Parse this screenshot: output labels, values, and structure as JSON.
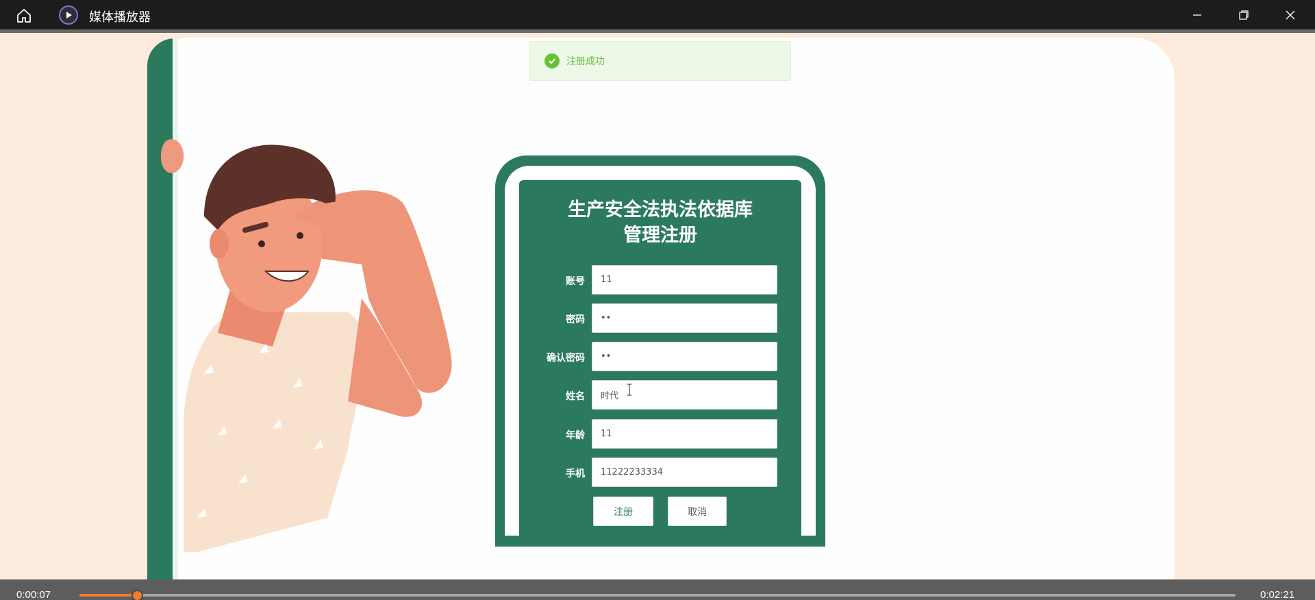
{
  "window": {
    "title": "媒体播放器",
    "accent": "#8a72d8"
  },
  "toast": {
    "message": "注册成功",
    "color": "#67c23a"
  },
  "form": {
    "title": "生产安全法执法依据库管理注册",
    "fields": [
      {
        "label": "账号",
        "value": "11"
      },
      {
        "label": "密码",
        "value": "••"
      },
      {
        "label": "确认密码",
        "value": "••"
      },
      {
        "label": "姓名",
        "value": "时代"
      },
      {
        "label": "年龄",
        "value": "11"
      },
      {
        "label": "手机",
        "value": "11222233334"
      }
    ],
    "submit_label": "注册",
    "cancel_label": "取消",
    "brand_color": "#2c7a5d"
  },
  "player": {
    "current_time": "0:00:07",
    "total_time": "0:02:21",
    "progress": 0.05,
    "accent": "#ef7c2f"
  }
}
